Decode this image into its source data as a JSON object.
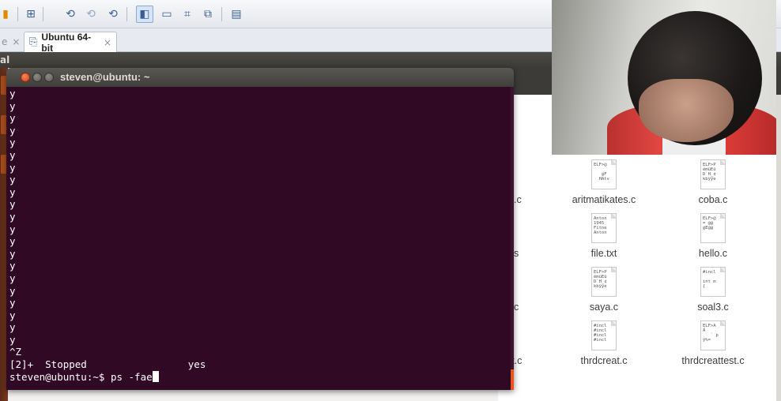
{
  "colors": {
    "terminal_bg": "#300a24",
    "terminal_fg": "#ffffff",
    "ubuntu_orange": "#e95420",
    "panel_bg": "#3c3b37"
  },
  "toolbar": {
    "icons": [
      "vm-power-icon",
      "send-ctrl-alt-del-icon",
      "snapshot-icon",
      "revert-snapshot-icon",
      "snapshot-manager-icon",
      "console-view-icon",
      "fullscreen-icon",
      "unity-icon",
      "stretch-icon",
      "thumbnail-icon"
    ]
  },
  "tabs": {
    "active_label": "Ubuntu 64-bit",
    "close_glyph": "×"
  },
  "top_panel": {
    "title_fragment": "al"
  },
  "terminal": {
    "title": "steven@ubuntu: ~",
    "lines": [
      "y",
      "y",
      "y",
      "y",
      "y",
      "y",
      "y",
      "y",
      "y",
      "y",
      "y",
      "y",
      "y",
      "y",
      "y",
      "y",
      "y",
      "y",
      "y",
      "y",
      "y",
      "^Z",
      "[2]+  Stopped                 yes"
    ],
    "prompt": "steven@ubuntu:~$ ",
    "command": "ps -fae"
  },
  "files": {
    "partial": [
      ".c",
      "s",
      "c",
      "est.c"
    ],
    "items": [
      {
        "name": "aritmatikates.c",
        "preview": "ELF>@\n\n   @F\n  HAtv"
      },
      {
        "name": "coba.c",
        "preview": "ELF>P\némüEü\nD`H_¢\nkbÿÿe"
      },
      {
        "name": "file.txt",
        "preview": "Anton\n1945\nFitne\nAnton"
      },
      {
        "name": "hello.c",
        "preview": "ELF>@\n= @@\n@E@@"
      },
      {
        "name": "saya.c",
        "preview": "ELF>P\némüEü\nD`H_¢\nkbÿÿe"
      },
      {
        "name": "soal3.c",
        "preview": "#incl\n\nint m\n{"
      },
      {
        "name": "thrdcreat.c",
        "preview": "#incl\n#incl\n#incl\n#incl"
      },
      {
        "name": "thrdcreattest.c",
        "preview": "ELF>A\nÄ\n   ` p\nÿ%="
      }
    ]
  }
}
